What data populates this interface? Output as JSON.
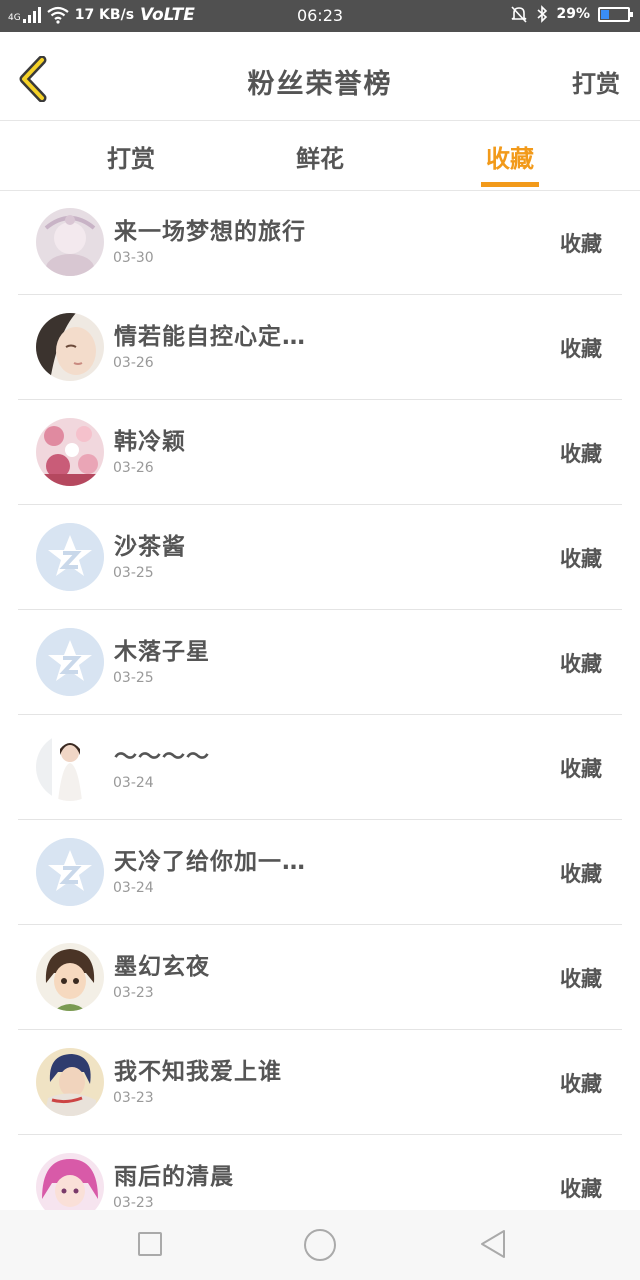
{
  "status_bar": {
    "network_type": "4G",
    "speed": "17 KB/s",
    "volte": "VoLTE",
    "time": "06:23",
    "battery": "29%",
    "battery_level": 0.29
  },
  "header": {
    "title": "粉丝荣誉榜",
    "right_label": "打赏"
  },
  "tabs": [
    {
      "label": "打赏",
      "active": false
    },
    {
      "label": "鲜花",
      "active": false
    },
    {
      "label": "收藏",
      "active": true
    }
  ],
  "list": [
    {
      "name": "来一场梦想的旅行",
      "date": "03-30",
      "action": "收藏",
      "avatar": "avatar-pink-lace"
    },
    {
      "name": "情若能自控心定…",
      "date": "03-26",
      "action": "收藏",
      "avatar": "avatar-girl-face"
    },
    {
      "name": "韩冷颖",
      "date": "03-26",
      "action": "收藏",
      "avatar": "avatar-flowers"
    },
    {
      "name": "沙茶酱",
      "date": "03-25",
      "action": "收藏",
      "avatar": "avatar-default-z"
    },
    {
      "name": "木落子星",
      "date": "03-25",
      "action": "收藏",
      "avatar": "avatar-default-z"
    },
    {
      "name": "～～～～",
      "date": "03-24",
      "action": "收藏",
      "avatar": "avatar-girl-white-dress"
    },
    {
      "name": "天冷了给你加一…",
      "date": "03-24",
      "action": "收藏",
      "avatar": "avatar-default-z"
    },
    {
      "name": "墨幻玄夜",
      "date": "03-23",
      "action": "收藏",
      "avatar": "avatar-anime-character"
    },
    {
      "name": "我不知我爱上谁",
      "date": "03-23",
      "action": "收藏",
      "avatar": "avatar-anime-blue-scarf"
    },
    {
      "name": "雨后的清晨",
      "date": "03-23",
      "action": "收藏",
      "avatar": "avatar-anime-pink-hair"
    }
  ],
  "colors": {
    "accent": "#f29a1a",
    "text": "#555555",
    "date": "#999999",
    "status_bar_bg": "#505050"
  }
}
